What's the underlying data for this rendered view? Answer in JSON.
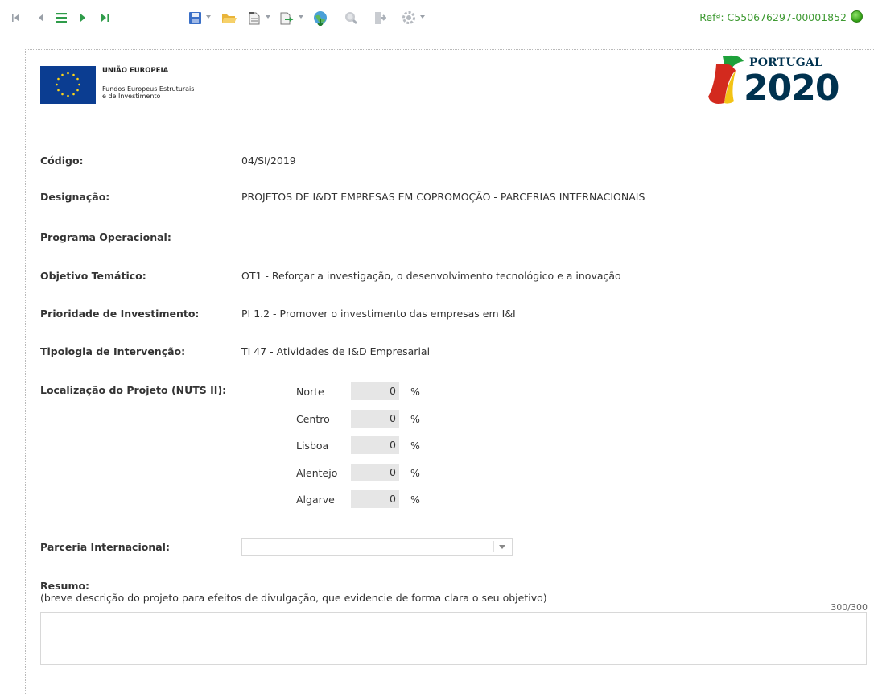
{
  "toolbar": {
    "buttons": [
      {
        "name": "first-record-icon"
      },
      {
        "name": "previous-record-icon"
      },
      {
        "name": "list-icon"
      },
      {
        "name": "next-record-icon"
      },
      {
        "name": "last-record-icon"
      },
      {
        "name": "save-icon"
      },
      {
        "name": "open-folder-icon"
      },
      {
        "name": "new-document-icon"
      },
      {
        "name": "export-icon"
      },
      {
        "name": "globe-submit-icon"
      },
      {
        "name": "search-icon"
      },
      {
        "name": "exit-icon"
      },
      {
        "name": "settings-gear-icon"
      }
    ],
    "reference": "Refª: C550676297-00001852",
    "status_color": "#3aa51a"
  },
  "header": {
    "eu_title": "UNIÃO EUROPEIA",
    "eu_line1": "Fundos Europeus Estruturais",
    "eu_line2": "e de Investimento",
    "portugal": "PORTUGAL",
    "year": "2020"
  },
  "form": {
    "codigo_label": "Código:",
    "codigo_value": "04/SI/2019",
    "designacao_label": "Designação:",
    "designacao_value": "PROJETOS DE I&DT EMPRESAS EM COPROMOÇÃO - PARCERIAS INTERNACIONAIS",
    "programa_label": "Programa Operacional:",
    "objetivo_label": "Objetivo Temático:",
    "objetivo_value": "OT1 - Reforçar a investigação, o desenvolvimento tecnológico e a inovação",
    "prioridade_label": "Prioridade de Investimento:",
    "prioridade_value": "PI 1.2 - Promover o investimento das empresas em I&I",
    "tipologia_label": "Tipologia de Intervenção:",
    "tipologia_value": "TI 47 - Atividades de I&D Empresarial",
    "localizacao_label": "Localização do Projeto (NUTS II):",
    "nuts": [
      {
        "region": "Norte",
        "value": "0",
        "unit": "%"
      },
      {
        "region": "Centro",
        "value": "0",
        "unit": "%"
      },
      {
        "region": "Lisboa",
        "value": "0",
        "unit": "%"
      },
      {
        "region": "Alentejo",
        "value": "0",
        "unit": "%"
      },
      {
        "region": "Algarve",
        "value": "0",
        "unit": "%"
      }
    ],
    "parceria_label": "Parceria Internacional:",
    "parceria_value": "",
    "resumo_label": "Resumo:",
    "resumo_hint": "(breve descrição do projeto para efeitos de divulgação, que evidencie de forma clara o seu objetivo)",
    "resumo_counter": "300/300",
    "resumo_value": ""
  }
}
